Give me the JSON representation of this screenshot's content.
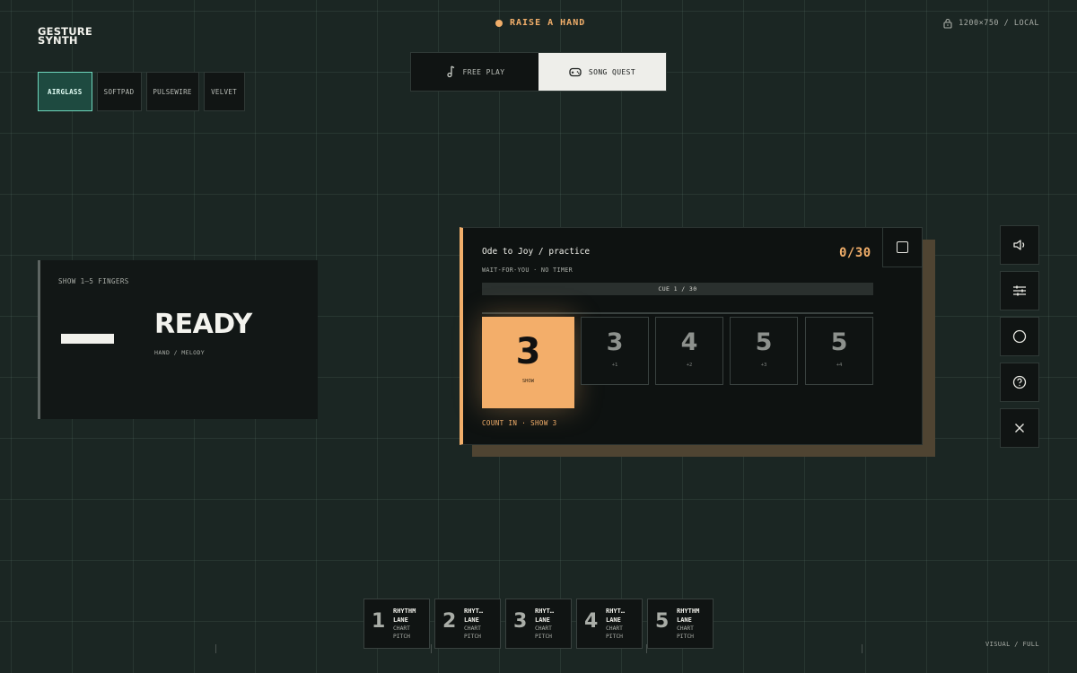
{
  "app": {
    "logo_line1": "GESTURE",
    "logo_line2": "SYNTH"
  },
  "presets": [
    {
      "label": "AIRGLASS",
      "active": true
    },
    {
      "label": "SOFTPAD",
      "active": false
    },
    {
      "label": "PULSEWIRE",
      "active": false
    },
    {
      "label": "VELVET",
      "active": false
    }
  ],
  "status": {
    "prompt": "RAISE A HAND",
    "resolution": "1200×750 / LOCAL"
  },
  "modes": [
    {
      "label": "FREE PLAY",
      "icon": "music-note-icon",
      "active": false
    },
    {
      "label": "SONG QUEST",
      "icon": "gamepad-icon",
      "active": true
    }
  ],
  "ready": {
    "hint": "SHOW 1–5 FINGERS",
    "title": "READY",
    "subtitle": "HAND / MELODY"
  },
  "song": {
    "title": "Ode to Joy / practice",
    "meta": "WAIT-FOR-YOU · NO TIMER",
    "score": "0/30",
    "cue": "CUE 1 / 30",
    "current": {
      "number": "3",
      "label": "SHOW"
    },
    "upcoming": [
      {
        "number": "3",
        "label": "+1"
      },
      {
        "number": "4",
        "label": "+2"
      },
      {
        "number": "5",
        "label": "+3"
      },
      {
        "number": "5",
        "label": "+4"
      }
    ],
    "count_in": "COUNT IN · SHOW 3"
  },
  "toolbar": [
    "volume-icon",
    "sliders-icon",
    "record-icon",
    "help-icon",
    "close-icon"
  ],
  "lanes": [
    {
      "number": "1",
      "line1": "RHYTHM",
      "line2": "LANE",
      "line3": "CHART",
      "line4": "PITCH"
    },
    {
      "number": "2",
      "line1": "RHYTHM",
      "line2": "LANE",
      "line3": "CHART",
      "line4": "PITCH"
    },
    {
      "number": "3",
      "line1": "RHYTHM",
      "line2": "LANE",
      "line3": "CHART",
      "line4": "PITCH"
    },
    {
      "number": "4",
      "line1": "RHYTHM",
      "line2": "LANE",
      "line3": "CHART",
      "line4": "PITCH"
    },
    {
      "number": "5",
      "line1": "RHYTHM",
      "line2": "LANE",
      "line3": "CHART",
      "line4": "PITCH"
    }
  ],
  "footer": {
    "view_mode": "VISUAL / FULL"
  },
  "colors": {
    "accent": "#f1ae6a",
    "active_preset": "#6fd7bd",
    "background": "#1b2623"
  }
}
